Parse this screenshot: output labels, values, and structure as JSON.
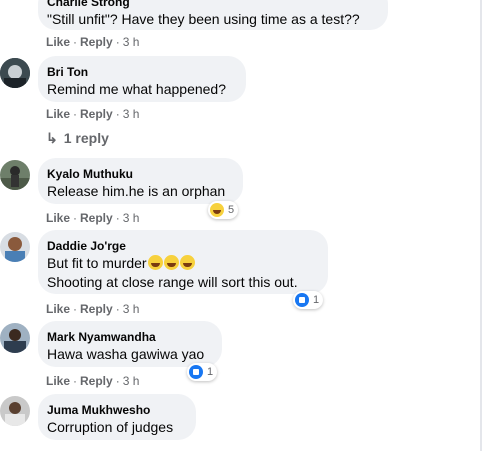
{
  "comments": [
    {
      "author": "Charlie Strong",
      "text": "\"Still unfit\"? Have they been using time as a test??",
      "like": "Like",
      "reply": "Reply",
      "time": "3 h"
    },
    {
      "author": "Bri Ton",
      "text": "Remind me what happened?",
      "like": "Like",
      "reply": "Reply",
      "time": "3 h",
      "replies_link": "1 reply"
    },
    {
      "author": "Kyalo Muthuku",
      "text": "Release him.he is an orphan",
      "like": "Like",
      "reply": "Reply",
      "time": "3 h",
      "reaction": {
        "type": "haha",
        "count": "5"
      }
    },
    {
      "author": "Daddie Jo'rge",
      "text_line1": "But fit to murder",
      "text_line2": "Shooting at close range will sort this out.",
      "like": "Like",
      "reply": "Reply",
      "time": "3 h",
      "reaction": {
        "type": "like",
        "count": "1"
      }
    },
    {
      "author": "Mark Nyamwandha",
      "text": "Hawa washa gawiwa yao",
      "like": "Like",
      "reply": "Reply",
      "time": "3 h",
      "reaction": {
        "type": "like",
        "count": "1"
      }
    },
    {
      "author": "Juma Mukhwesho",
      "text": "Corruption of judges"
    }
  ],
  "colors": {
    "bubble": "#f0f2f5",
    "secondary_text": "#65676b",
    "like_blue": "#1877f2"
  }
}
